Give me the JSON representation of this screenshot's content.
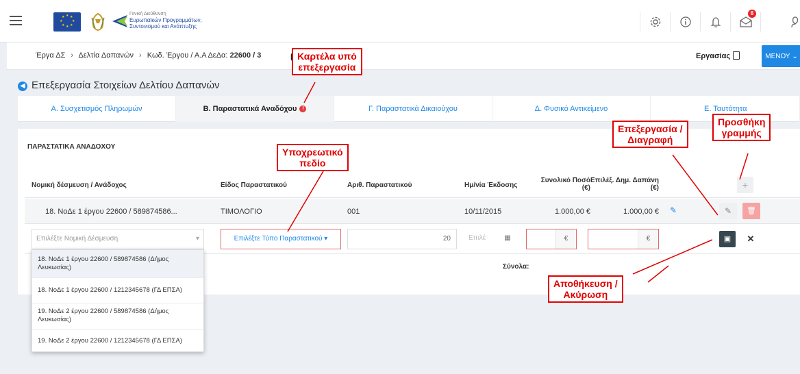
{
  "topbar": {
    "logo_line1": "Γενική Διεύθυνση",
    "logo_line2": "Ευρωπαϊκών Προγραμμάτων,",
    "logo_line3": "Συντονισμού και Ανάπτυξης",
    "notification_count": "6"
  },
  "breadcrumb": {
    "item1": "Έργα ΔΣ",
    "item2": "Δελτία Δαπανών",
    "item3_prefix": "Κωδ. Έργου / Α.Α ΔεΔα:",
    "item3_value": "22600 / 3",
    "work_label": "Εργασίας",
    "menu_label": "ΜΕΝΟΥ"
  },
  "page": {
    "title": "Επεξεργασία Στοιχείων Δελτίου Δαπανών"
  },
  "tabs": [
    {
      "label": "Α. Συσχετισμός Πληρωμών"
    },
    {
      "label": "Β. Παραστατικά Αναδόχου"
    },
    {
      "label": "Γ. Παραστατικά Δικαιούχου"
    },
    {
      "label": "Δ. Φυσικό Αντικείμενο"
    },
    {
      "label": "Ε. Ταυτότητα"
    }
  ],
  "panel": {
    "title": "ΠΑΡΑΣΤΑΤΙΚΑ ΑΝΑΔΟΧΟΥ",
    "columns": {
      "commitment": "Νομική δέσμευση / Ανάδοχος",
      "doc_type": "Είδος Παραστατικού",
      "doc_number": "Αριθ. Παραστατικού",
      "issue_date": "Ημ/νία Έκδοσης",
      "total_line1": "Συνολικό Ποσό",
      "total_line2": "(€)",
      "eligible_line1": "Επιλέξ. Δημ. Δαπάνη",
      "eligible_line2": "(€)"
    },
    "row": {
      "commitment": "18. ΝοΔε 1 έργου 22600 / 589874586...",
      "doc_type": "ΤΙΜΟΛΟΓΙΟ",
      "doc_number": "001",
      "issue_date": "10/11/2015",
      "total": "1.000,00 €",
      "eligible": "1.000,00 €"
    },
    "edit_row": {
      "commitment_placeholder": "Επιλέξτε Νομική Δέσμευση",
      "doc_type_placeholder": "Επιλέξτε Τύπο Παραστατικού",
      "char_counter": "20",
      "date_placeholder": "Επιλέ",
      "currency": "€"
    },
    "totals_label": "Σύνολα:"
  },
  "dropdown": {
    "options": [
      {
        "line1": "18. ΝοΔε 1 έργου 22600 / 589874586 (Δήμος",
        "line2": "Λευκωσίας)"
      },
      {
        "line1": "18. ΝοΔε 1 έργου 22600 / 1212345678 (ΓΔ ΕΠΣΑ)",
        "line2": ""
      },
      {
        "line1": "19. ΝοΔε 2 έργου 22600 / 589874586 (Δήμος",
        "line2": "Λευκωσίας)"
      },
      {
        "line1": "19. ΝοΔε 2 έργου 22600 / 1212345678 (ΓΔ ΕΠΣΑ)",
        "line2": ""
      }
    ]
  },
  "annotations": {
    "tab_editing_line1": "Καρτέλα υπό",
    "tab_editing_line2": "επεξεργασία",
    "required_line1": "Υποχρεωτικό",
    "required_line2": "πεδίο",
    "edit_delete_line1": "Επεξεργασία /",
    "edit_delete_line2": "Διαγραφή",
    "add_row_line1": "Προσθήκη",
    "add_row_line2": "γραμμής",
    "save_cancel_line1": "Αποθήκευση /",
    "save_cancel_line2": "Ακύρωση"
  },
  "colors": {
    "accent": "#1e88e5",
    "annotation": "#e00000",
    "error": "#e23b3b"
  }
}
